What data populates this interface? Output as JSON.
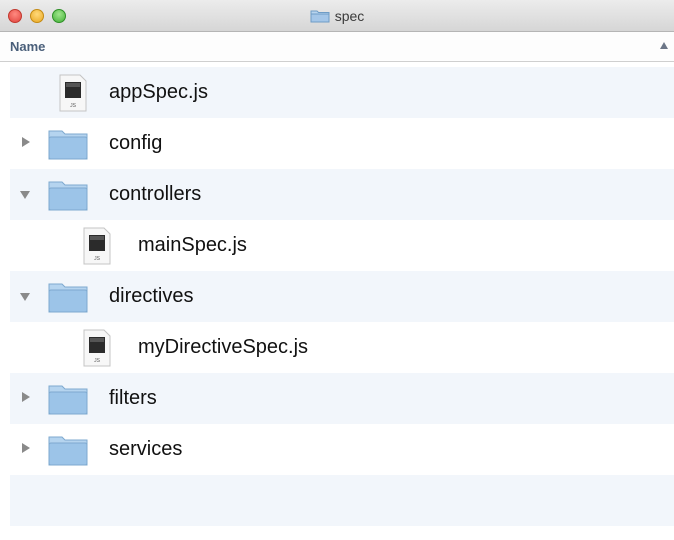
{
  "window": {
    "title": "spec"
  },
  "header": {
    "name_label": "Name"
  },
  "rows": [
    {
      "label": "appSpec.js",
      "type": "file",
      "file_badge": "JS"
    },
    {
      "label": "config",
      "type": "folder",
      "expanded": false
    },
    {
      "label": "controllers",
      "type": "folder",
      "expanded": true
    },
    {
      "label": "mainSpec.js",
      "type": "file",
      "file_badge": "JS"
    },
    {
      "label": "directives",
      "type": "folder",
      "expanded": true
    },
    {
      "label": "myDirectiveSpec.js",
      "type": "file",
      "file_badge": "JS"
    },
    {
      "label": "filters",
      "type": "folder",
      "expanded": false
    },
    {
      "label": "services",
      "type": "folder",
      "expanded": false
    }
  ],
  "colors": {
    "folder": "#8fbbe0",
    "alt_row": "#f2f6fb",
    "header_text": "#4a5f7a"
  }
}
